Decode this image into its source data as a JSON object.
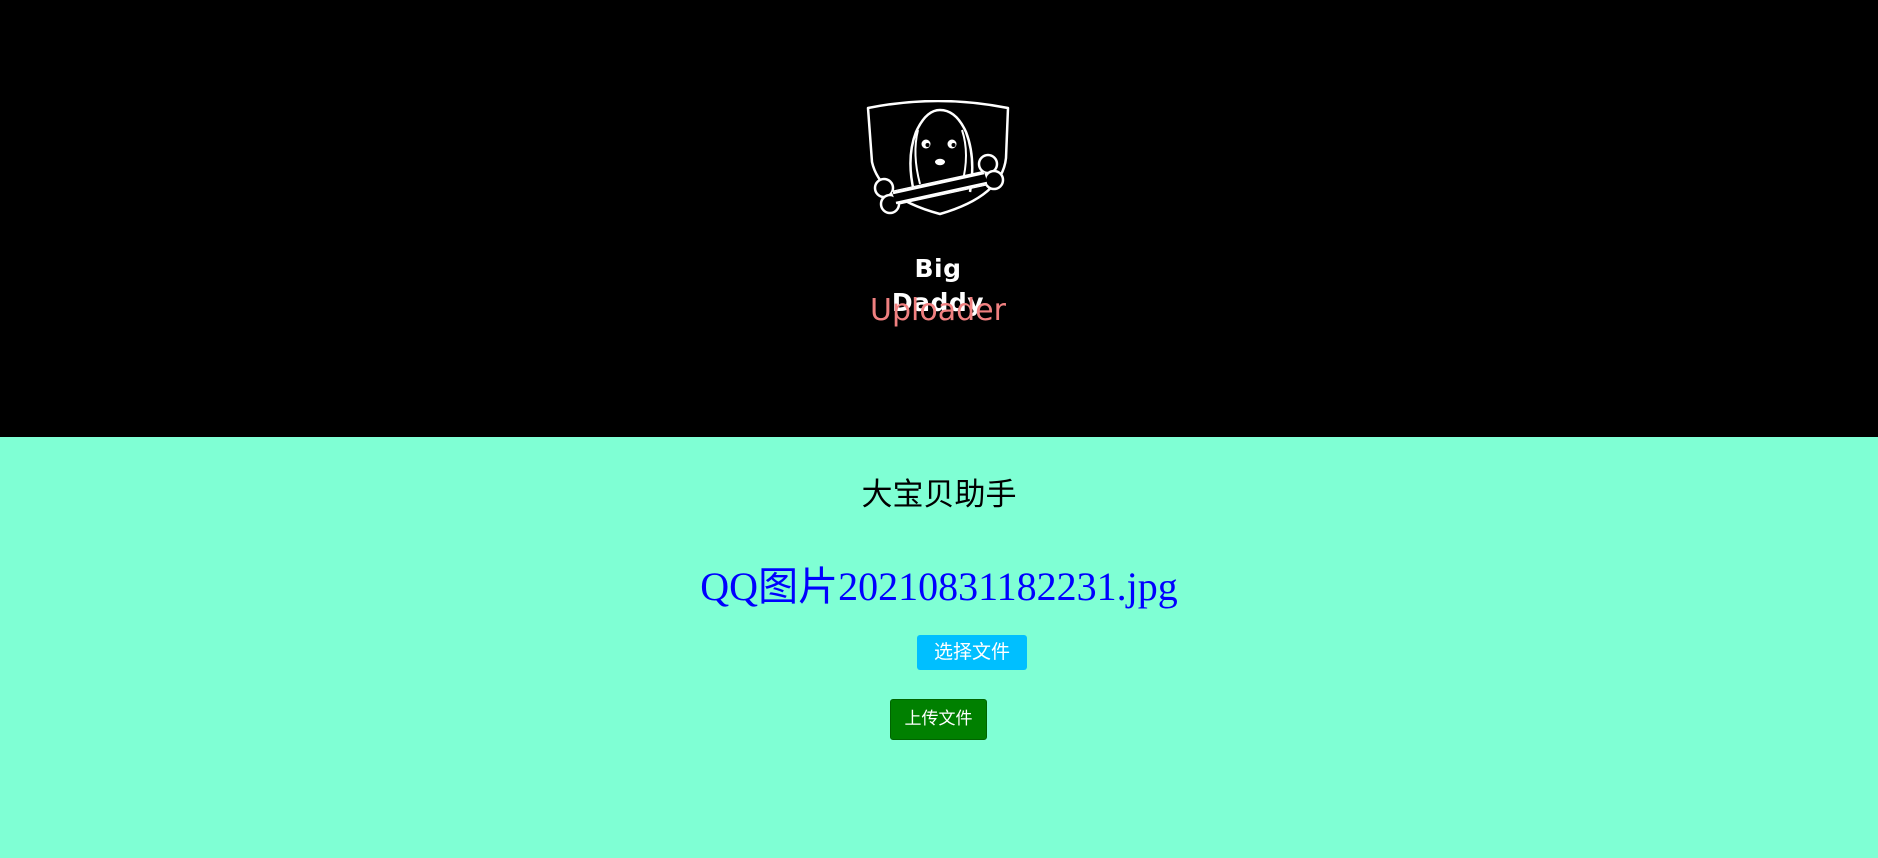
{
  "header": {
    "logo_icon": "dog-with-bone-shield-icon",
    "logo_title": "Big Daddy",
    "logo_subtitle": "Uploader",
    "background_color": "#000000",
    "subtitle_color": "#f08080"
  },
  "main": {
    "background_color": "#7fffd4",
    "app_title": "大宝贝助手",
    "selected_file_name": "QQ图片20210831182231.jpg",
    "choose_file_label": "选择文件",
    "upload_label": "上传文件",
    "file_name_color": "#0000ff",
    "choose_button_color": "#00bfff",
    "upload_button_color": "#008000"
  }
}
